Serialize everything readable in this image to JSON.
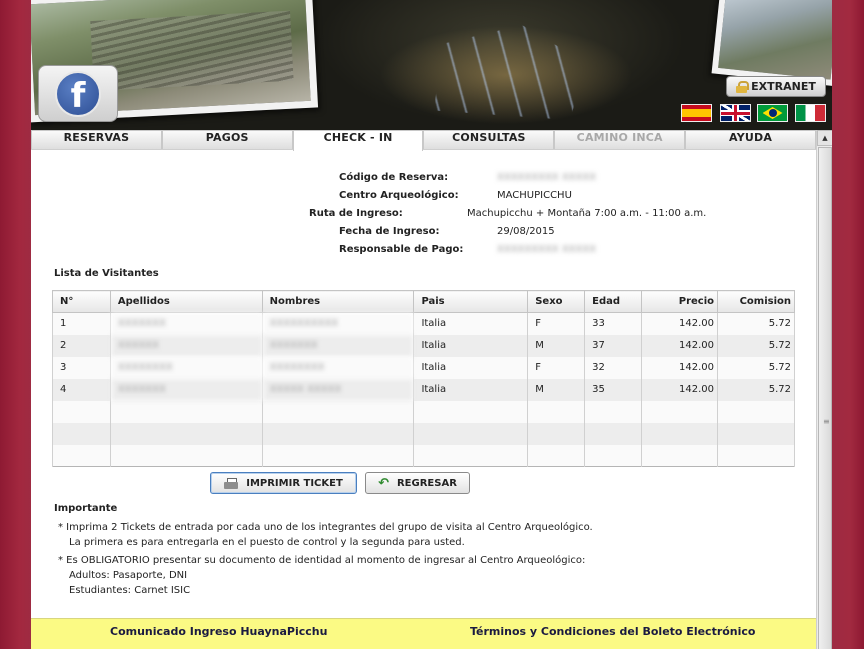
{
  "banner": {
    "extranet_label": "EXTRANET",
    "facebook_glyph": "f",
    "flags": [
      "es-flag",
      "uk-flag",
      "br-flag",
      "it-flag"
    ]
  },
  "nav": {
    "tabs": [
      {
        "label": "RESERVAS",
        "state": "normal"
      },
      {
        "label": "PAGOS",
        "state": "normal"
      },
      {
        "label": "CHECK - IN",
        "state": "active"
      },
      {
        "label": "CONSULTAS",
        "state": "normal"
      },
      {
        "label": "CAMINO INCA",
        "state": "disabled"
      },
      {
        "label": "AYUDA",
        "state": "normal"
      }
    ]
  },
  "reservation": {
    "code_label": "Código de Reserva:",
    "code_value": "XXXXXXXXX XXXXX",
    "site_label": "Centro Arqueológico:",
    "site_value": "MACHUPICCHU",
    "route_label": "Ruta de Ingreso:",
    "route_value": "Machupicchu + Montaña 7:00 a.m. - 11:00 a.m.",
    "date_label": "Fecha de Ingreso:",
    "date_value": "29/08/2015",
    "payer_label": "Responsable de Pago:",
    "payer_value": "XXXXXXXXX XXXXX"
  },
  "visitors": {
    "title": "Lista de Visitantes",
    "columns": [
      "N°",
      "Apellidos",
      "Nombres",
      "Pais",
      "Sexo",
      "Edad",
      "Precio",
      "Comision"
    ],
    "rows": [
      {
        "n": "1",
        "apellidos": "XXXXXXX",
        "nombres": "XXXXXXXXXX",
        "pais": "Italia",
        "sexo": "F",
        "edad": "33",
        "precio": "142.00",
        "comision": "5.72"
      },
      {
        "n": "2",
        "apellidos": "XXXXXX",
        "nombres": "XXXXXXX",
        "pais": "Italia",
        "sexo": "M",
        "edad": "37",
        "precio": "142.00",
        "comision": "5.72"
      },
      {
        "n": "3",
        "apellidos": "XXXXXXXX",
        "nombres": "XXXXXXXX",
        "pais": "Italia",
        "sexo": "F",
        "edad": "32",
        "precio": "142.00",
        "comision": "5.72"
      },
      {
        "n": "4",
        "apellidos": "XXXXXXX",
        "nombres": "XXXXX XXXXX",
        "pais": "Italia",
        "sexo": "M",
        "edad": "35",
        "precio": "142.00",
        "comision": "5.72"
      }
    ],
    "empty_rows": 3
  },
  "actions": {
    "print_label": "IMPRIMIR TICKET",
    "back_label": "REGRESAR"
  },
  "important": {
    "title": "Importante",
    "note1_line1": "* Imprima 2 Tickets de entrada por cada uno de los integrantes del grupo de visita al Centro Arqueológico.",
    "note1_line2": "La primera es para entregarla en el puesto de control y la segunda para usted.",
    "note2_line1": "* Es OBLIGATORIO presentar su documento de identidad al momento de ingresar al Centro Arqueológico:",
    "note2_line2": "Adultos: Pasaporte, DNI",
    "note2_line3": "Estudiantes: Carnet ISIC"
  },
  "footer": {
    "left_link": "Comunicado Ingreso HuaynaPicchu",
    "right_link": "Términos y Condiciones del Boleto Electrónico"
  }
}
